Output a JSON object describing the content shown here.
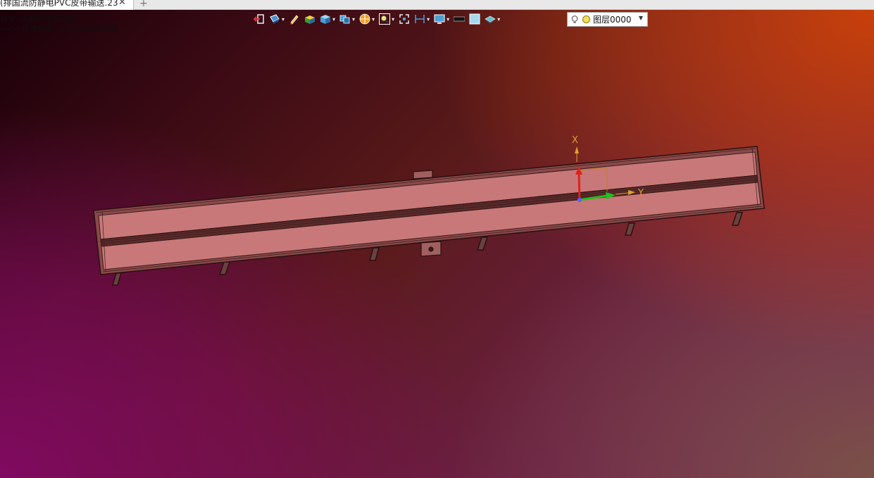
{
  "tab": {
    "title": "(排国流防静电PVC皮带输送.23",
    "close_glyph": "✕",
    "new_glyph": "+"
  },
  "command_prompt": {
    "line1": "命令: 选取对象或选择",
    "line2": "<<< 按住右键 > 显示选择过滤器"
  },
  "toolbar": {
    "items": [
      {
        "icon": "exit-icon"
      },
      {
        "icon": "view-direction-icon"
      },
      {
        "icon": "pencil-icon"
      },
      {
        "icon": "box-shaded-icon"
      },
      {
        "icon": "cube-icon"
      },
      {
        "icon": "view-cube-icon"
      },
      {
        "icon": "render-icon"
      },
      {
        "icon": "zoom-icon"
      },
      {
        "icon": "fit-icon"
      },
      {
        "icon": "dimension-icon"
      },
      {
        "icon": "monitor-icon"
      },
      {
        "icon": "line-color-icon"
      },
      {
        "icon": "fill-color-icon"
      },
      {
        "icon": "layer-stack-icon"
      }
    ],
    "layer": {
      "name": "图层0000"
    }
  },
  "triad": {
    "x_label": "X",
    "y_label": "Y"
  },
  "colors": {
    "belt_fill": "#c87878",
    "frame_line": "#3a1a1a",
    "axis_x": "#e02020",
    "axis_y": "#20c020",
    "axis_label": "#e0a030"
  }
}
